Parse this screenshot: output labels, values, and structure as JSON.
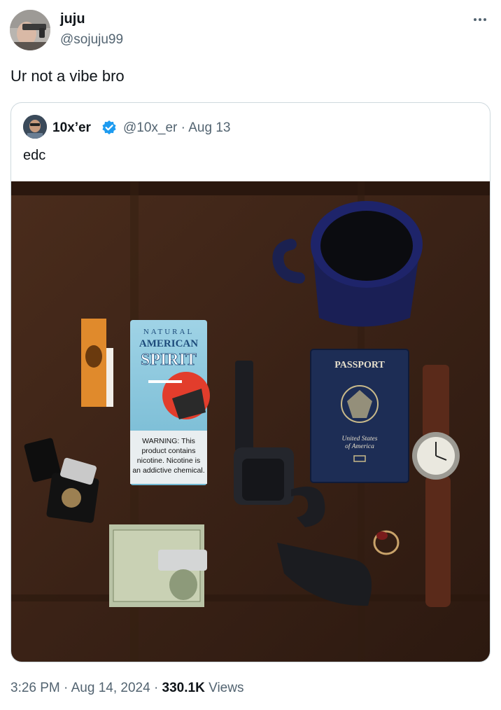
{
  "tweet": {
    "author": {
      "name": "juju",
      "handle": "@sojuju99"
    },
    "text": "Ur not a vibe bro",
    "more_icon": "more-horizontal-icon",
    "quoted": {
      "author": {
        "name": "10x’er",
        "handle": "@10x_er",
        "verified": true,
        "verified_color": "#1d9bf0"
      },
      "separator": "·",
      "date": "Aug 13",
      "text": "edc",
      "photo": {
        "tobacco_pouch": {
          "brand_top": "NATURAL",
          "brand_mid": "AMERICAN",
          "brand_main": "SPIRIT",
          "warning": [
            "WARNING: This",
            "product contains",
            "nicotine. Nicotine is",
            "an addictive chemical."
          ]
        },
        "passport": {
          "title": "PASSPORT",
          "subtitle": [
            "United States",
            "of America"
          ]
        }
      }
    },
    "meta": {
      "time": "3:26 PM",
      "separator": "·",
      "date": "Aug 14, 2024",
      "views_count": "330.1K",
      "views_label": "Views"
    }
  },
  "colors": {
    "text_primary": "#0f1419",
    "text_secondary": "#536471",
    "border": "#cfd9de",
    "table_wood": "#3b2418"
  }
}
